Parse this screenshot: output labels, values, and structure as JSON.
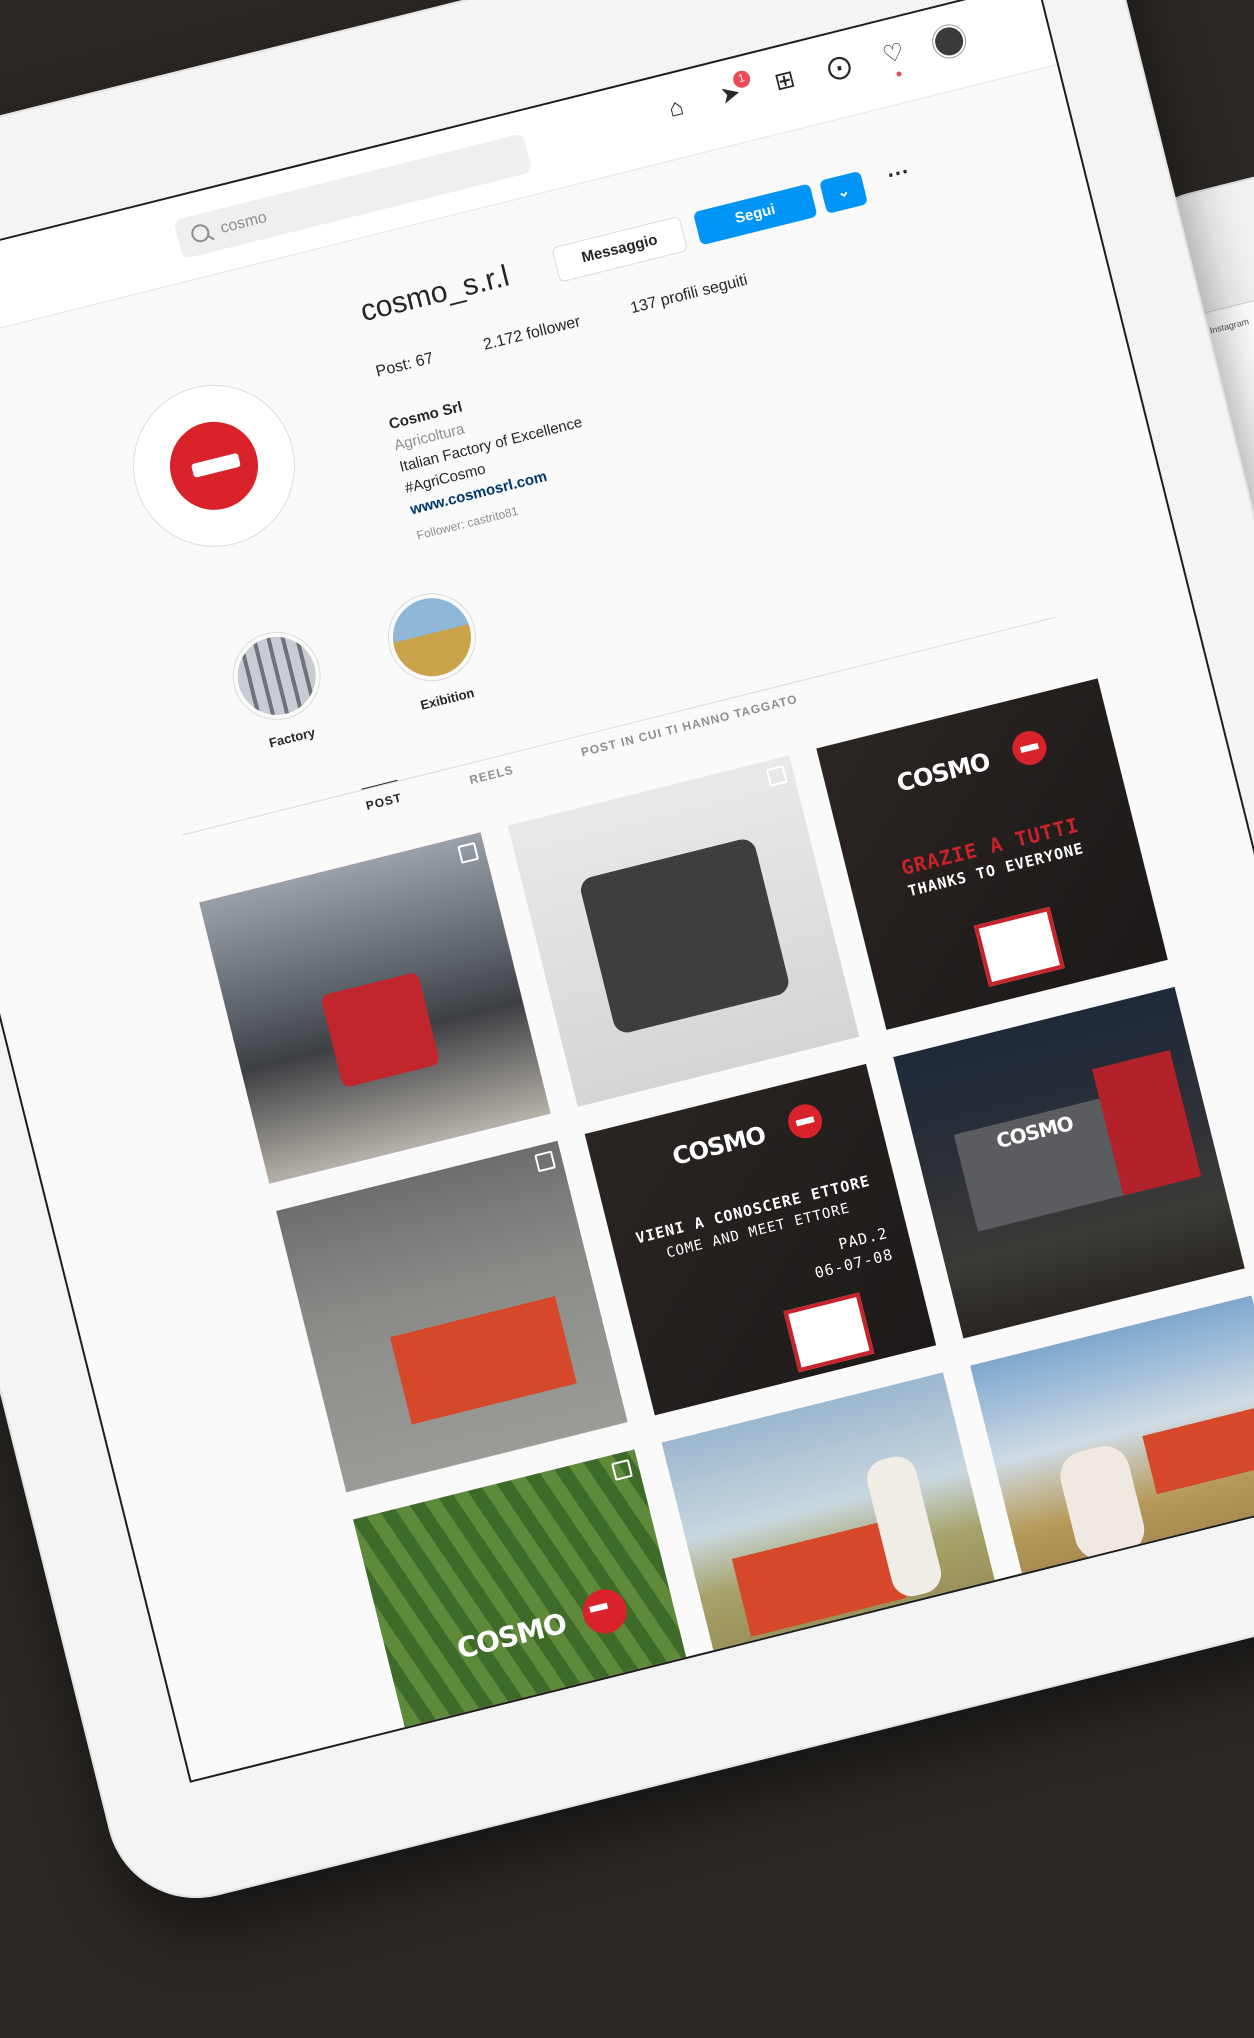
{
  "search": {
    "query": "cosmo"
  },
  "nav": {
    "icons": [
      "home-icon",
      "direct-icon",
      "new-post-icon",
      "explore-icon",
      "activity-icon",
      "profile-avatar"
    ],
    "direct_badge": "1"
  },
  "profile": {
    "username": "cosmo_s.r.l",
    "message_label": "Messaggio",
    "follow_label": "Segui",
    "more_label": "···",
    "stats": {
      "posts": "Post: 67",
      "followers": "2.172 follower",
      "following": "137 profili seguiti"
    },
    "name": "Cosmo Srl",
    "category": "Agricoltura",
    "bio_line1": "Italian Factory of Excellence",
    "bio_line2": "#AgriCosmo",
    "link": "www.cosmosrl.com",
    "followed_by": "Follower: castrito81"
  },
  "stories": [
    {
      "label": "Factory"
    },
    {
      "label": "Exibition"
    }
  ],
  "tabs": {
    "post": "POST",
    "reels": "REELS",
    "tagged": "POST IN CUI TI HANNO TAGGATO"
  },
  "posts": {
    "p3_brand": "COSMO",
    "p3_line1": "GRAZIE A TUTTI",
    "p3_line2": "THANKS TO EVERYONE",
    "p5_brand": "COSMO",
    "p5_line1": "VIENI A CONOSCERE ETTORE",
    "p5_line2": "COME AND MEET ETTORE",
    "p5_pad": "PAD.2",
    "p5_dates": "06-07-08",
    "p6_sign": "COSMO",
    "p7_brand": "COSMO"
  },
  "colors": {
    "brand_red": "#d9222a",
    "follow_blue": "#0095f6"
  },
  "second_device": {
    "label": "Instagram"
  }
}
